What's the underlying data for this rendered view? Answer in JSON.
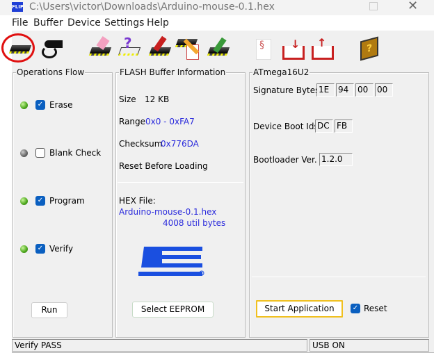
{
  "window": {
    "title": "C:\\Users\\victor\\Downloads\\Arduino-mouse-0.1.hex",
    "app_icon": "FLIP"
  },
  "menu": [
    "File",
    "Buffer",
    "Device",
    "Settings",
    "Help"
  ],
  "toolbar": [
    "select-device-icon",
    "usb-communication-icon",
    "erase-icon",
    "blank-check-icon",
    "program-icon",
    "verify-icon",
    "read-icon",
    "load-hex-icon",
    "open-buffer-icon",
    "save-buffer-icon",
    "help-book-icon"
  ],
  "ops": {
    "title": "Operations Flow",
    "items": [
      {
        "label": "Erase",
        "checked": true,
        "led": "green"
      },
      {
        "label": "Blank Check",
        "checked": false,
        "led": "gray"
      },
      {
        "label": "Program",
        "checked": true,
        "led": "green"
      },
      {
        "label": "Verify",
        "checked": true,
        "led": "green"
      }
    ],
    "run": "Run"
  },
  "flash": {
    "title": "FLASH Buffer Information",
    "size_label": "Size",
    "size": "12 KB",
    "range_label": "Range",
    "range": "0x0 - 0xFA7",
    "checksum_label": "Checksum",
    "checksum": "0x776DA",
    "reset": "Reset Before Loading",
    "hex_label": "HEX File:",
    "hex_file": "Arduino-mouse-0.1.hex",
    "bytes": "4008 util bytes",
    "logo": "ATMEL",
    "eeprom": "Select EEPROM"
  },
  "device": {
    "title": "ATmega16U2",
    "sig_label": "Signature Bytes",
    "sig": [
      "1E",
      "94",
      "00",
      "00"
    ],
    "boot_label": "Device Boot Ids",
    "boot": [
      "DC",
      "FB"
    ],
    "ver_label": "Bootloader Ver.",
    "ver": "1.2.0",
    "start": "Start Application",
    "reset": "Reset"
  },
  "status": {
    "left": "Verify PASS",
    "right": "USB ON"
  }
}
